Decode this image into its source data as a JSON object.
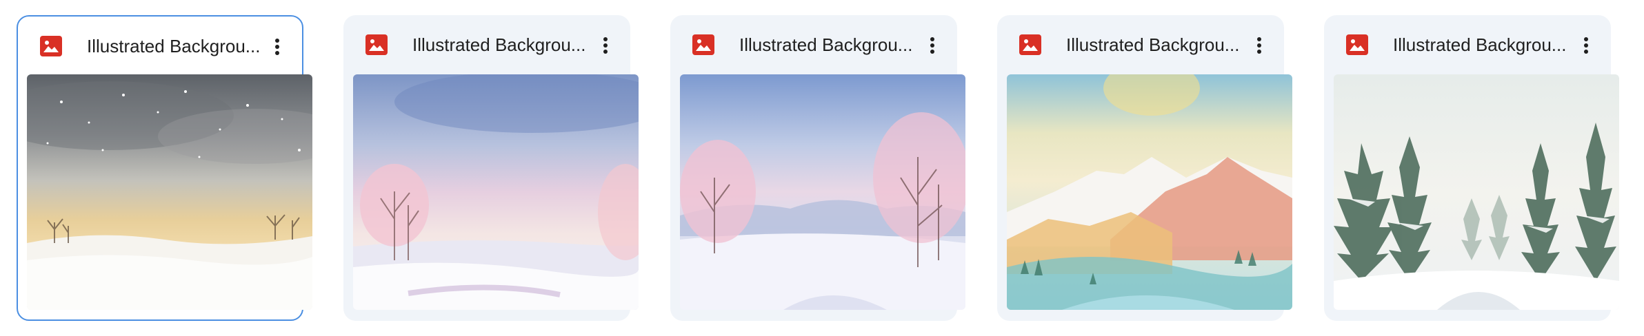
{
  "files": [
    {
      "title": "Illustrated Backgrou...",
      "icon": "image-file-icon",
      "thumbnail": "winter-night-snow-field",
      "selected": true
    },
    {
      "title": "Illustrated Backgrou...",
      "icon": "image-file-icon",
      "thumbnail": "pastel-winter-meadow",
      "selected": false
    },
    {
      "title": "Illustrated Backgrou...",
      "icon": "image-file-icon",
      "thumbnail": "pink-trees-snowy-valley",
      "selected": false
    },
    {
      "title": "Illustrated Backgrou...",
      "icon": "image-file-icon",
      "thumbnail": "watercolor-mountains",
      "selected": false
    },
    {
      "title": "Illustrated Backgrou...",
      "icon": "image-file-icon",
      "thumbnail": "snowy-pine-forest",
      "selected": false
    }
  ],
  "colors": {
    "icon_red": "#d93025",
    "selection_border": "#4b8fe2",
    "card_bg": "#f0f4f9"
  }
}
